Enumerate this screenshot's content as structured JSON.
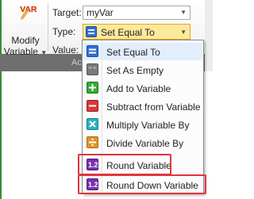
{
  "ribbon": {
    "modify_button": {
      "icon_text": "VAR",
      "label_line1": "Modify",
      "label_line2": "Variable"
    },
    "target": {
      "label": "Target:",
      "value": "myVar"
    },
    "type": {
      "label": "Type:",
      "value": "Set Equal To"
    },
    "value": {
      "label": "Value:"
    },
    "group_label_partial": "Acti"
  },
  "menu": {
    "items": [
      {
        "label": "Set Equal To",
        "icon": "set-equal-icon",
        "color": "#2f6fd6"
      },
      {
        "label": "Set As Empty",
        "icon": "set-empty-icon",
        "color": "#7a7a7a"
      },
      {
        "label": "Add to Variable",
        "icon": "add-icon",
        "color": "#3aa83a"
      },
      {
        "label": "Subtract from Variable",
        "icon": "subtract-icon",
        "color": "#d63a3a"
      },
      {
        "label": "Multiply Variable By",
        "icon": "multiply-icon",
        "color": "#2ab0c0"
      },
      {
        "label": "Divide Variable By",
        "icon": "divide-icon",
        "color": "#e0952a"
      },
      {
        "label": "Round Variable",
        "icon": "round-icon",
        "color": "#7a2fb0"
      },
      {
        "label": "Round Down Variable",
        "icon": "round-down-icon",
        "color": "#7a2fb0"
      }
    ]
  }
}
